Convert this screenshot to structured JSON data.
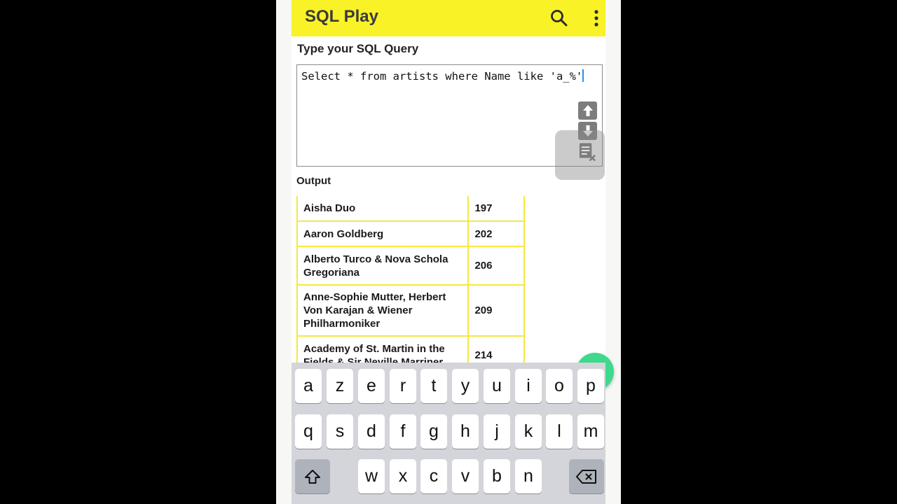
{
  "app": {
    "title": "SQL Play"
  },
  "query": {
    "label": "Type your SQL Query",
    "text": "Select * from artists where Name like 'a_%'"
  },
  "output": {
    "label": "Output",
    "rows": [
      {
        "name": "Aisha Duo",
        "id": "197"
      },
      {
        "name": "Aaron Goldberg",
        "id": "202"
      },
      {
        "name": "Alberto Turco & Nova Schola Gregoriana",
        "id": "206"
      },
      {
        "name": "Anne-Sophie Mutter, Herbert Von Karajan & Wiener Philharmoniker",
        "id": "209"
      },
      {
        "name": "Academy of St. Martin in the Fields & Sir Neville Marriner",
        "id": "214"
      }
    ]
  },
  "keyboard": {
    "row1": [
      "a",
      "z",
      "e",
      "r",
      "t",
      "y",
      "u",
      "i",
      "o",
      "p"
    ],
    "row2": [
      "q",
      "s",
      "d",
      "f",
      "g",
      "h",
      "j",
      "k",
      "l",
      "m"
    ],
    "row3": [
      "w",
      "x",
      "c",
      "v",
      "b",
      "n"
    ]
  },
  "icons": {
    "search": "search-icon",
    "more": "more-vertical-icon",
    "up": "arrow-up-icon",
    "down": "arrow-down-icon",
    "clear": "clear-text-icon",
    "run": "send-icon",
    "shift": "shift-icon",
    "backspace": "backspace-icon"
  },
  "colors": {
    "app_bar": "#f8f227",
    "table_border": "#f6e740",
    "fab": "#3ed98a"
  }
}
